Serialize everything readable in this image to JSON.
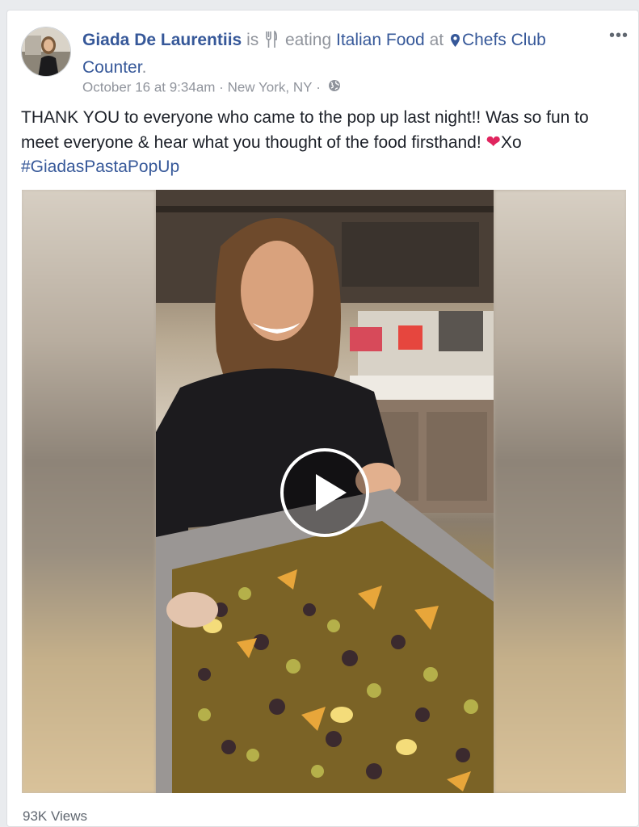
{
  "post": {
    "author": "Giada De Laurentiis",
    "is_text": "is",
    "activity_icon": "fork-knife-icon",
    "activity_verb": "eating",
    "activity_object": "Italian Food",
    "at_text": "at",
    "place_icon": "map-pin-icon",
    "place": "Chefs Club Counter",
    "period": ".",
    "timestamp": "October 16 at 9:34am",
    "separator": "·",
    "location": "New York, NY",
    "privacy_icon": "globe-icon",
    "more_label": "•••",
    "text": "THANK YOU to everyone who came to the pop up last night!! Was so fun to meet everyone & hear what you thought of the food firsthand! ",
    "heart": "❤",
    "sign_off": "Xo",
    "hashtag": "#GiadasPastaPopUp"
  },
  "video": {
    "play_icon": "play-icon",
    "views": "93K Views"
  },
  "colors": {
    "link": "#365899",
    "muted": "#90949c",
    "text": "#1d2129",
    "heart": "#e0245e"
  }
}
